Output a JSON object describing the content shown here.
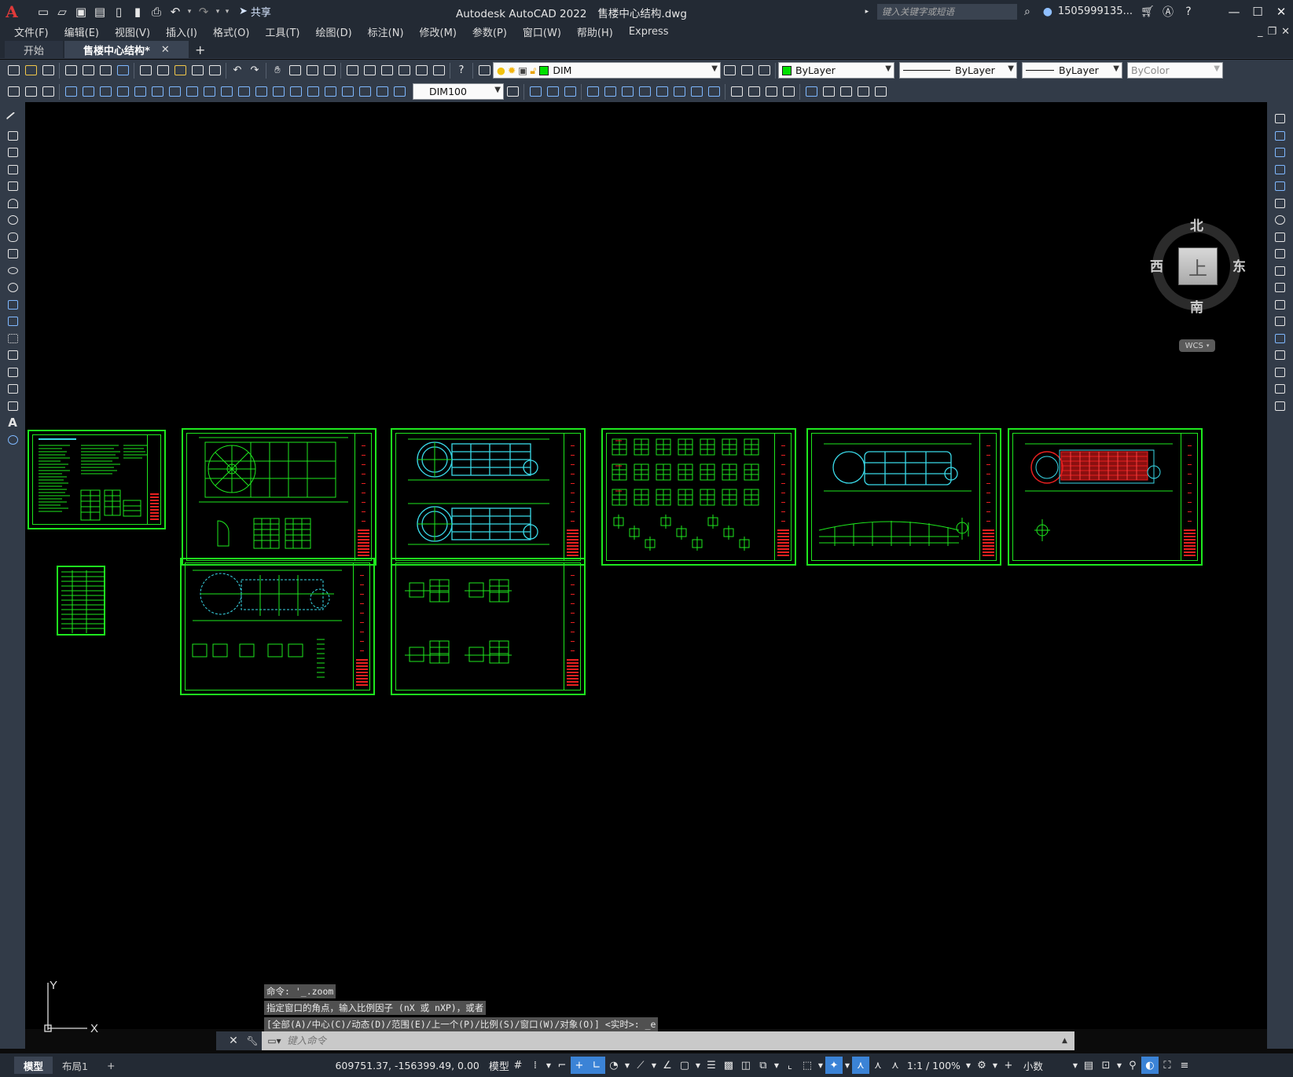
{
  "app": {
    "logo": "A",
    "title": "Autodesk AutoCAD 2022",
    "document": "售楼中心结构.dwg",
    "share_label": "共享",
    "search_placeholder": "键入关键字或短语",
    "user": "1505999135...",
    "window_controls": [
      "minimize-icon",
      "maximize-icon",
      "close-icon"
    ]
  },
  "menubar": {
    "items": [
      "文件(F)",
      "编辑(E)",
      "视图(V)",
      "插入(I)",
      "格式(O)",
      "工具(T)",
      "绘图(D)",
      "标注(N)",
      "修改(M)",
      "参数(P)",
      "窗口(W)",
      "帮助(H)",
      "Express"
    ]
  },
  "tabs": {
    "items": [
      {
        "label": "开始",
        "active": false
      },
      {
        "label": "售楼中心结构*",
        "active": true
      }
    ],
    "add": "+"
  },
  "toolbar": {
    "layer": "DIM",
    "color": "ByLayer",
    "linetype": "ByLayer",
    "lineweight": "ByLayer",
    "plotstyle": "ByColor",
    "dimstyle": "DIM100"
  },
  "viewcube": {
    "north": "北",
    "south": "南",
    "east": "东",
    "west": "西",
    "face": "上",
    "wcs": "WCS"
  },
  "ucs": {
    "x": "X",
    "y": "Y"
  },
  "command": {
    "history": [
      "命令: '_.zoom",
      "指定窗口的角点，输入比例因子 (nX 或 nXP)，或者",
      "[全部(A)/中心(C)/动态(D)/范围(E)/上一个(P)/比例(S)/窗口(W)/对象(O)] <实时>: _e"
    ],
    "placeholder": "键入命令"
  },
  "status": {
    "layouts": [
      {
        "label": "模型",
        "active": true
      },
      {
        "label": "布局1",
        "active": false
      }
    ],
    "add": "+",
    "coords": "609751.37, -156399.49, 0.00",
    "model": "模型",
    "scale": "1:1 / 100%",
    "units": "小数"
  },
  "colors": {
    "accent": "#3b83d6",
    "drawing_green": "#1ee81e",
    "drawing_cyan": "#3ad9e8",
    "drawing_red": "#e82020",
    "title_bar": "#232a34",
    "toolbar": "#323b48"
  }
}
